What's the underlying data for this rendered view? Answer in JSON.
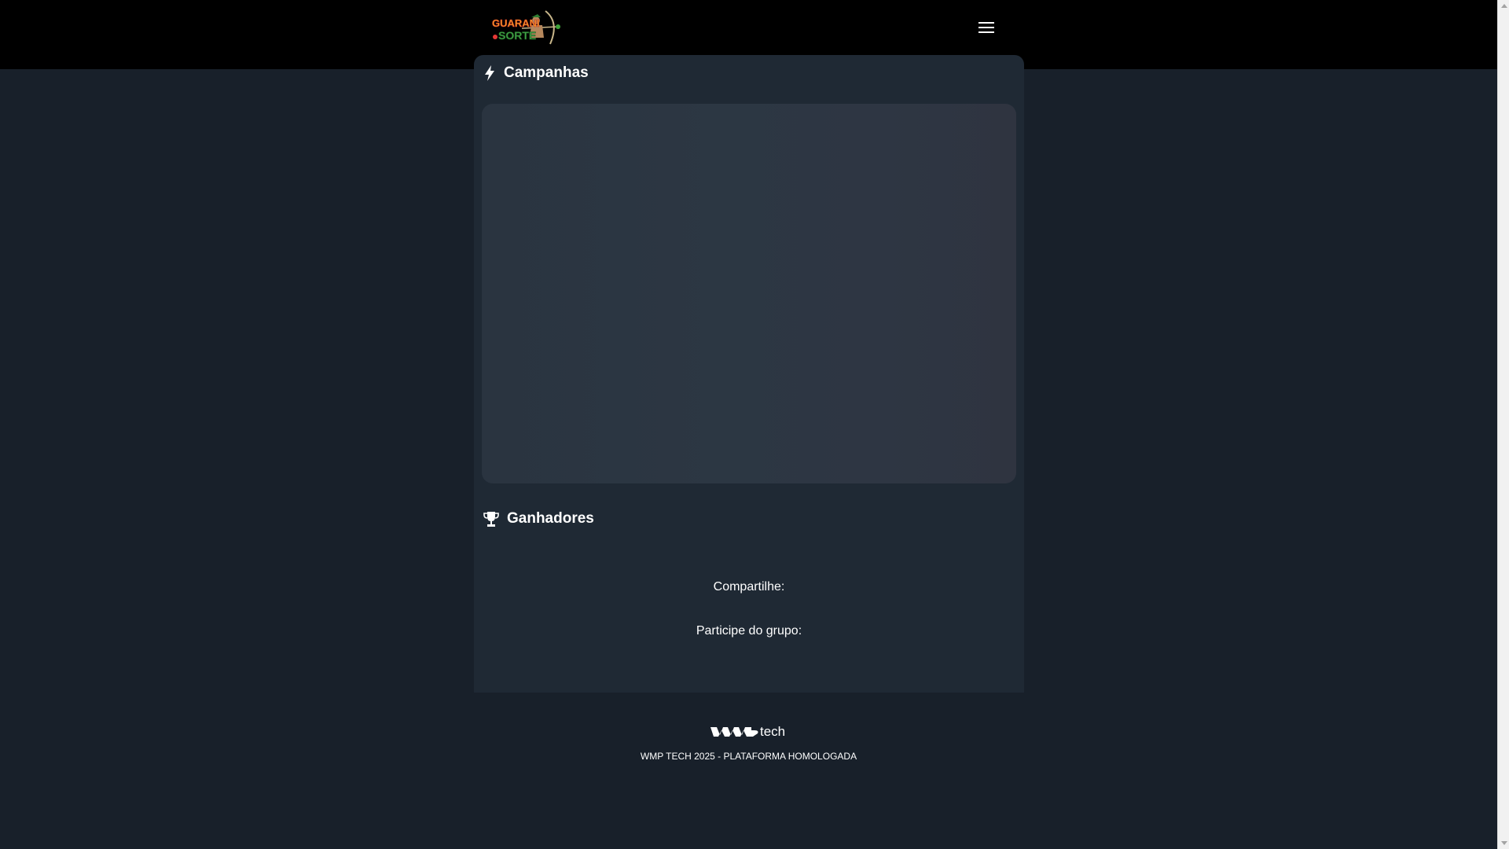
{
  "header": {
    "logo_alt": "Guarani Sorte",
    "menu_icon": "hamburger-menu-icon"
  },
  "sections": {
    "campanhas": {
      "title": "Campanhas",
      "icon": "lightning-bolt-icon"
    },
    "ganhadores": {
      "title": "Ganhadores",
      "icon": "trophy-icon"
    }
  },
  "share": {
    "label": "Compartilhe:"
  },
  "group": {
    "label": "Participe do grupo:"
  },
  "footer": {
    "brand_suffix": "tech",
    "copyright": "WMP TECH 2025 - PLATAFORMA HOMOLOGADA"
  },
  "colors": {
    "topbar": "#000000",
    "page_bg": "#18202a",
    "panel_bg": "#1f2934",
    "card_bg": "#2c3743"
  }
}
